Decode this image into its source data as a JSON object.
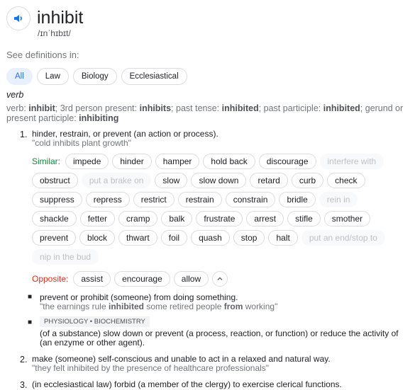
{
  "word": "inhibit",
  "phonetic": "/ɪnˈhɪbɪt/",
  "see_definitions": "See definitions in:",
  "tabs": [
    "All",
    "Law",
    "Biology",
    "Ecclesiastical"
  ],
  "pos": "verb",
  "forms": {
    "p1": "verb: ",
    "w1": "inhibit",
    "p2": "; 3rd person present: ",
    "w2": "inhibits",
    "p3": "; past tense: ",
    "w3": "inhibited",
    "p4": "; past participle: ",
    "w4": "inhibited",
    "p5": "; gerund or present participle: ",
    "w5": "inhibiting"
  },
  "sense1": {
    "num": "1.",
    "def": "hinder, restrain, or prevent (an action or process).",
    "example": "\"cold inhibits plant growth\"",
    "similar_label": "Similar:",
    "similar": [
      [
        "impede",
        0
      ],
      [
        "hinder",
        0
      ],
      [
        "hamper",
        0
      ],
      [
        "hold back",
        0
      ],
      [
        "discourage",
        0
      ],
      [
        "interfere with",
        1
      ],
      [
        "obstruct",
        0
      ],
      [
        "put a brake on",
        1
      ],
      [
        "slow",
        0
      ],
      [
        "slow down",
        0
      ],
      [
        "retard",
        0
      ],
      [
        "curb",
        0
      ],
      [
        "check",
        0
      ],
      [
        "suppress",
        0
      ],
      [
        "repress",
        0
      ],
      [
        "restrict",
        0
      ],
      [
        "restrain",
        0
      ],
      [
        "constrain",
        0
      ],
      [
        "bridle",
        0
      ],
      [
        "rein in",
        1
      ],
      [
        "shackle",
        0
      ],
      [
        "fetter",
        0
      ],
      [
        "cramp",
        0
      ],
      [
        "balk",
        0
      ],
      [
        "frustrate",
        0
      ],
      [
        "arrest",
        0
      ],
      [
        "stifle",
        0
      ],
      [
        "smother",
        0
      ],
      [
        "prevent",
        0
      ],
      [
        "block",
        0
      ],
      [
        "thwart",
        0
      ],
      [
        "foil",
        0
      ],
      [
        "quash",
        0
      ],
      [
        "stop",
        0
      ],
      [
        "halt",
        0
      ],
      [
        "put an end/stop to",
        1
      ],
      [
        "nip in the bud",
        1
      ]
    ],
    "opposite_label": "Opposite:",
    "opposite": [
      "assist",
      "encourage",
      "allow"
    ]
  },
  "sub1": {
    "def": "prevent or prohibit (someone) from doing something.",
    "ex1": "\"the earnings rule ",
    "exb1": "inhibited",
    "ex2": " some retired people ",
    "exb2": "from",
    "ex3": " working\""
  },
  "sub2": {
    "tag": "PHYSIOLOGY • BIOCHEMISTRY",
    "def": "(of a substance) slow down or prevent (a process, reaction, or function) or reduce the activity of (an enzyme or other agent)."
  },
  "sense2": {
    "num": "2.",
    "def": "make (someone) self-conscious and unable to act in a relaxed and natural way.",
    "example": "\"they felt inhibited by the presence of healthcare professionals\""
  },
  "sense3": {
    "num": "3.",
    "def": "(in ecclesiastical law) forbid (a member of the clergy) to exercise clerical functions."
  },
  "colors": {
    "accent": "#1a73e8",
    "similar": "#188038",
    "opposite": "#d93025"
  }
}
